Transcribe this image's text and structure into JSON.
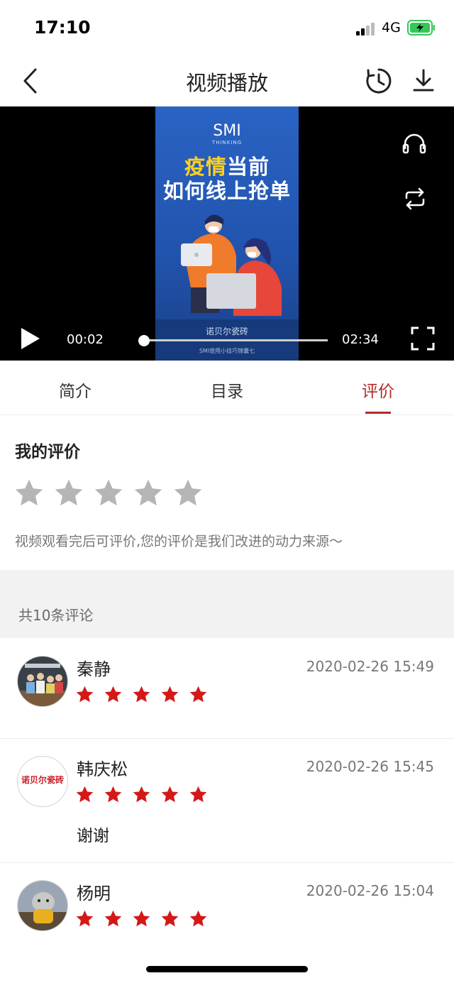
{
  "status": {
    "time": "17:10",
    "network": "4G"
  },
  "nav": {
    "title": "视频播放",
    "back_icon": "chevron-left-icon",
    "history_icon": "clock-icon",
    "download_icon": "download-icon"
  },
  "player": {
    "poster": {
      "brand": "SMI",
      "brand_sub": "THINKING",
      "headline_highlight": "疫情",
      "headline_rest": "当前",
      "headline_line2": "如何线上抢单",
      "bottom_brand": "诺贝尔瓷砖",
      "bottom_caption": "SMI使用小技巧锦囊七"
    },
    "current_time": "00:02",
    "total_time": "02:34",
    "progress": 0.013
  },
  "tabs": [
    {
      "label": "简介",
      "active": false
    },
    {
      "label": "目录",
      "active": false
    },
    {
      "label": "评价",
      "active": true
    }
  ],
  "my_review": {
    "title": "我的评价",
    "rating": 0,
    "max_rating": 5,
    "hint": "视频观看完后可评价,您的评价是我们改进的动力来源～"
  },
  "comments_header": "共10条评论",
  "comments": [
    {
      "name": "秦静",
      "time": "2020-02-26 15:49",
      "rating": 5,
      "text": ""
    },
    {
      "name": "韩庆松",
      "time": "2020-02-26 15:45",
      "rating": 5,
      "text": "谢谢",
      "avatar_text": "诺贝尔瓷砖"
    },
    {
      "name": "杨明",
      "time": "2020-02-26 15:04",
      "rating": 5,
      "text": ""
    }
  ],
  "colors": {
    "accent": "#b3292a",
    "star_filled": "#d41818",
    "star_empty": "#b5b5b5"
  }
}
